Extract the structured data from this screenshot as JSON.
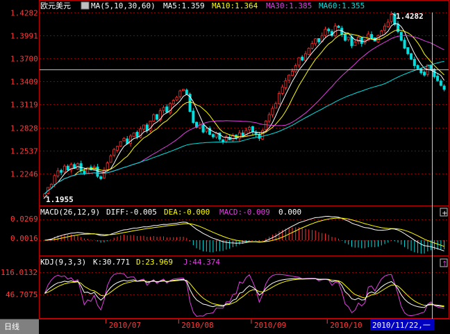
{
  "colors": {
    "up": "#ff3232",
    "down": "#00e0e0",
    "grid": "#c00000",
    "frame": "#c00000",
    "axis_text": "#ff3b3b",
    "ma5": "#ffffff",
    "ma10": "#ffff00",
    "ma30": "#e040e0",
    "ma60": "#00e0e0",
    "diff": "#ffffff",
    "dea": "#ffff00",
    "k": "#ffffff",
    "d": "#ffff00",
    "j": "#e040e0",
    "tab_bg": "#0000c0"
  },
  "main_panel": {
    "title": "欧元美元",
    "ma_label": "MA(5,10,30,60)",
    "ma5_label": "MA5:1.359",
    "ma10_label": "MA10:1.364",
    "ma30_label": "MA30:1.385",
    "ma60_label": "MA60:1.355",
    "high_label": "1.4282",
    "low_label": "1.1955",
    "ticks": [
      "1.4282",
      "1.3991",
      "1.3700",
      "1.3409",
      "1.3119",
      "1.2828",
      "1.2537",
      "1.2246"
    ]
  },
  "macd_panel": {
    "name": "MACD(26,12,9)",
    "diff_label": "DIFF:-0.005",
    "dea_label": "DEA:-0.000",
    "macd_label": "MACD:-0.009",
    "zero_label": "0.000",
    "ticks": [
      "0.0269",
      "0.0016"
    ]
  },
  "kdj_panel": {
    "name": "KDJ(9,3,3)",
    "k_label": "K:30.771",
    "d_label": "D:23.969",
    "j_label": "J:44.374",
    "ticks": [
      "116.0132",
      "46.7075"
    ]
  },
  "bottom_bar": {
    "period_tab": "日线",
    "months": [
      "2010/07",
      "2010/08",
      "2010/09",
      "2010/10"
    ],
    "cursor_date": "2010/11/22,一"
  },
  "chart_data": {
    "type": "candlestick",
    "title": "欧元美元",
    "ylim": [
      1.1955,
      1.4282
    ],
    "axis_ticks": [
      1.4282,
      1.3991,
      1.37,
      1.3409,
      1.3119,
      1.2828,
      1.2537,
      1.2246
    ],
    "x_month_labels": [
      "2010/07",
      "2010/08",
      "2010/09",
      "2010/10"
    ],
    "closes": [
      1.199,
      1.207,
      1.211,
      1.222,
      1.228,
      1.226,
      1.234,
      1.229,
      1.236,
      1.231,
      1.237,
      1.228,
      1.225,
      1.232,
      1.229,
      1.233,
      1.221,
      1.218,
      1.229,
      1.238,
      1.247,
      1.255,
      1.259,
      1.265,
      1.269,
      1.262,
      1.272,
      1.276,
      1.271,
      1.281,
      1.286,
      1.279,
      1.291,
      1.299,
      1.293,
      1.304,
      1.308,
      1.302,
      1.313,
      1.317,
      1.321,
      1.329,
      1.331,
      1.325,
      1.303,
      1.289,
      1.283,
      1.286,
      1.277,
      1.281,
      1.274,
      1.271,
      1.276,
      1.268,
      1.265,
      1.271,
      1.267,
      1.273,
      1.269,
      1.276,
      1.272,
      1.279,
      1.283,
      1.277,
      1.274,
      1.269,
      1.279,
      1.291,
      1.299,
      1.307,
      1.313,
      1.326,
      1.334,
      1.342,
      1.349,
      1.354,
      1.361,
      1.371,
      1.368,
      1.376,
      1.383,
      1.389,
      1.395,
      1.391,
      1.399,
      1.407,
      1.405,
      1.399,
      1.411,
      1.409,
      1.401,
      1.393,
      1.397,
      1.386,
      1.391,
      1.397,
      1.389,
      1.393,
      1.401,
      1.396,
      1.392,
      1.399,
      1.405,
      1.411,
      1.416,
      1.426,
      1.413,
      1.404,
      1.393,
      1.383,
      1.376,
      1.369,
      1.361,
      1.357,
      1.352,
      1.349,
      1.362,
      1.356,
      1.347,
      1.342,
      1.336,
      1.331
    ],
    "ma_periods": [
      5,
      10,
      30,
      60
    ],
    "ma_values_last": {
      "MA5": 1.359,
      "MA10": 1.364,
      "MA30": 1.385,
      "MA60": 1.355
    },
    "macd": {
      "params": [
        26,
        12,
        9
      ],
      "DIFF": -0.005,
      "DEA": -0.0,
      "MACD": -0.009,
      "ticks": [
        0.0269,
        0.0016
      ]
    },
    "kdj": {
      "params": [
        9,
        3,
        3
      ],
      "K": 30.771,
      "D": 23.969,
      "J": 44.374,
      "ticks": [
        116.0132,
        46.7075
      ]
    },
    "annotations": [
      {
        "text": "1.4282",
        "kind": "high"
      },
      {
        "text": "1.1955",
        "kind": "low"
      }
    ]
  }
}
